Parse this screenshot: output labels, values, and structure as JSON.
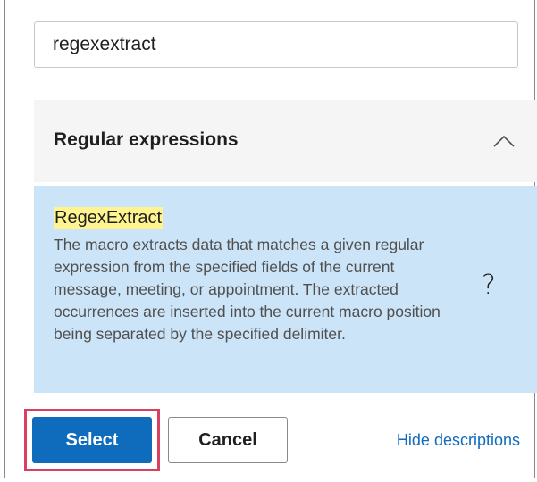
{
  "search": {
    "value": "regexextract",
    "placeholder": ""
  },
  "group": {
    "title": "Regular expressions",
    "expanded": true,
    "icon": "chevron-up-icon"
  },
  "items": [
    {
      "title": "RegexExtract",
      "description": "The macro extracts data that matches a given regular expression from the specified fields of the current message, meeting, or appointment. The extracted occurrences are inserted into the current macro position being separated by the specified delimiter.",
      "help_glyph": "?",
      "selected": true
    }
  ],
  "footer": {
    "select_label": "Select",
    "cancel_label": "Cancel",
    "toggle_descriptions_label": "Hide descriptions"
  },
  "colors": {
    "accent": "#0f6cbd",
    "selected_item_bg": "#cce4f7",
    "search_highlight": "#fff48f",
    "annotation_border": "#d7415f",
    "group_header_bg": "#f5f5f5"
  }
}
